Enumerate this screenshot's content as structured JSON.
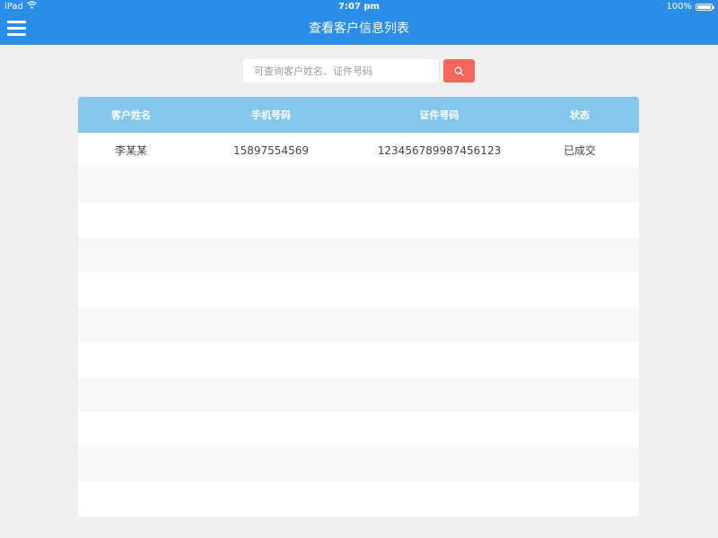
{
  "status_bar": {
    "device": "iPad",
    "time": "7:07 pm",
    "battery": "100%",
    "battery_level": 1.0
  },
  "nav": {
    "title": "查看客户信息列表"
  },
  "search": {
    "placeholder": "可查询客户姓名、证件号码",
    "value": ""
  },
  "table": {
    "columns": [
      "客户姓名",
      "手机号码",
      "证件号码",
      "状态"
    ],
    "rows": [
      [
        "李某某",
        "15897554569",
        "123456789987456123",
        "已成交"
      ]
    ]
  },
  "colors": {
    "nav_bg": "#2a8ee8",
    "header_bg": "#84c6ec",
    "search_button": "#f5655a",
    "page_bg": "#efefef"
  }
}
